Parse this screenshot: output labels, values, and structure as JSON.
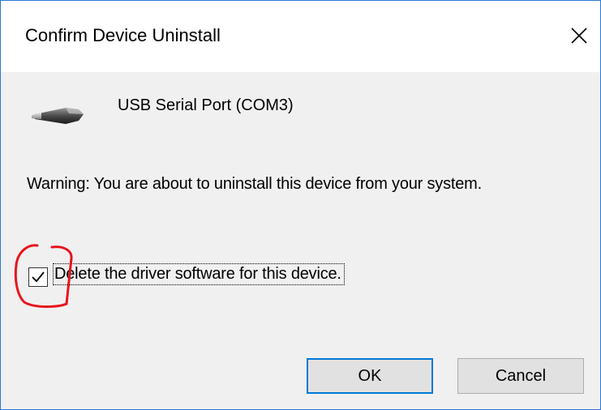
{
  "dialog": {
    "title": "Confirm Device Uninstall",
    "close_icon": "close-icon"
  },
  "device": {
    "icon": "usb-serial-port-icon",
    "name": "USB Serial Port (COM3)"
  },
  "warning_text": "Warning: You are about to uninstall this device from your system.",
  "delete_driver": {
    "label": "Delete the driver software for this device.",
    "checked": true
  },
  "buttons": {
    "ok": "OK",
    "cancel": "Cancel"
  },
  "colors": {
    "border_accent": "#2b79d6",
    "default_button_border": "#0078d7",
    "annotation": "#e8141c",
    "dialog_bg": "#f0f0f0"
  }
}
